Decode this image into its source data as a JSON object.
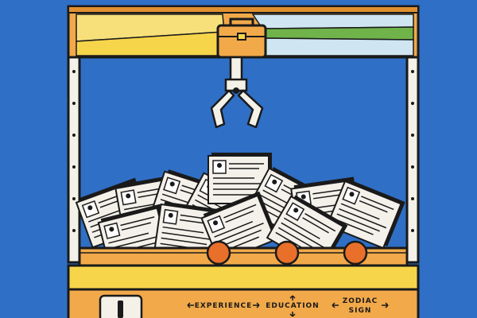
{
  "colors": {
    "background": "#2f6fc6",
    "cabinet_orange": "#f2a94a",
    "cabinet_yellow": "#f7d54a",
    "outline": "#1a1a1a",
    "joystick_ball": "#e8702a",
    "rail": "#f4f1e8",
    "paper": "#f4f1ea",
    "sky_ray_light": "#cfe6f2",
    "sky_ray_green": "#6fb34a",
    "sky_ray_yellow": "#f7e07a"
  },
  "icons": {
    "claw": "claw-icon",
    "briefcase": "briefcase-icon",
    "arrow": "double-arrow-icon"
  },
  "controls": {
    "labels": [
      {
        "id": "experience",
        "text": "EXPERIENCE"
      },
      {
        "id": "education",
        "text": "EDUCATION"
      },
      {
        "id": "zodiac_line1",
        "text": "ZODIAC"
      },
      {
        "id": "zodiac_line2",
        "text": "SIGN"
      }
    ]
  },
  "resume_count": 12
}
